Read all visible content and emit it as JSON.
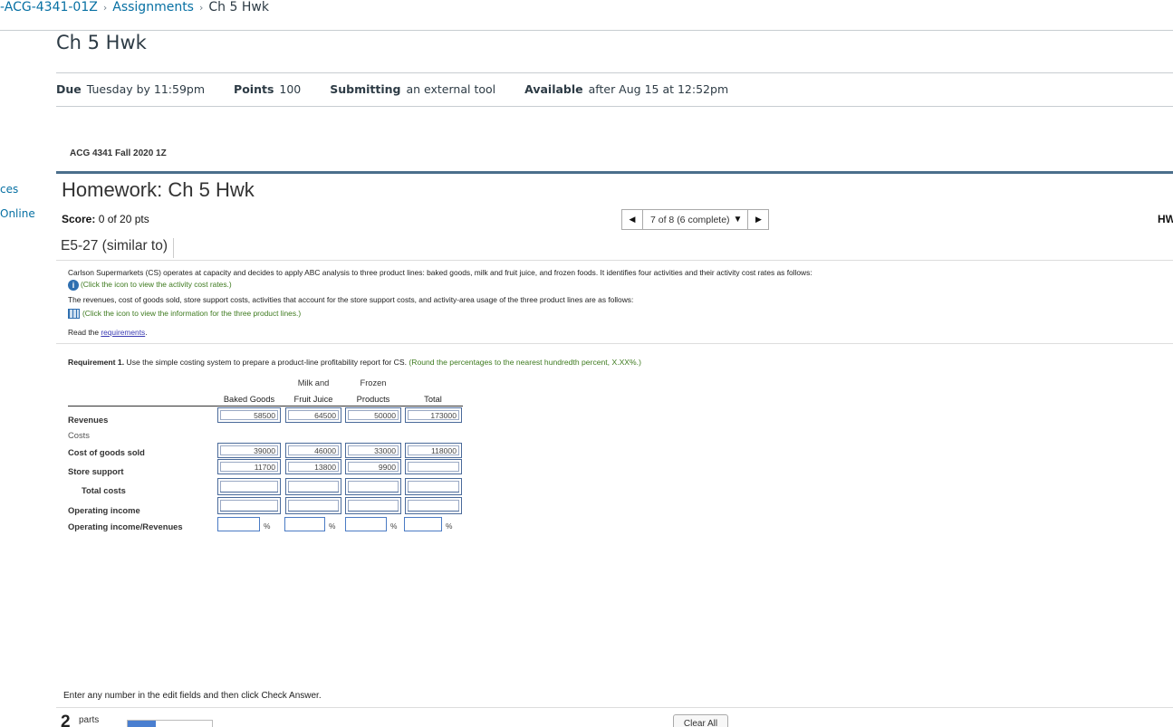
{
  "breadcrumb": {
    "course": "-ACG-4341-01Z",
    "assignments": "Assignments",
    "current": "Ch 5 Hwk"
  },
  "page_title": "Ch 5 Hwk",
  "details": {
    "due_label": "Due",
    "due_value": "Tuesday by 11:59pm",
    "points_label": "Points",
    "points_value": "100",
    "submitting_label": "Submitting",
    "submitting_value": "an external tool",
    "available_label": "Available",
    "available_value": "after Aug 15 at 12:52pm"
  },
  "left_nav": {
    "item1": "ces",
    "item2": "Online"
  },
  "course_name": "ACG 4341 Fall 2020 1Z",
  "homework": {
    "title": "Homework: Ch 5 Hwk",
    "score_label": "Score:",
    "score_value": "0 of 20 pts",
    "nav_position": "7 of 8 (6 complete)",
    "hw_cut": "HW"
  },
  "question": {
    "id": "E5-27 (similar to)",
    "line1": "Carlson Supermarkets (CS) operates at capacity and decides to apply ABC analysis to three product lines: baked goods, milk and fruit juice, and frozen foods. It identifies four activities and their activity cost rates as follows:",
    "link1": "(Click the icon to view the activity cost rates.)",
    "line2": "The revenues, cost of goods sold, store support costs, activities that account for the store support costs, and activity-area usage of the three product lines are as follows:",
    "link2": "(Click the icon to view the information for the three product lines.)",
    "read_prefix": "Read the ",
    "read_link": "requirements",
    "read_suffix": "."
  },
  "requirement": {
    "label": "Requirement 1.",
    "text": " Use the simple costing system to prepare a product-line profitability report for CS. ",
    "hint": "(Round the percentages to the nearest hundredth percent, X.XX%.)"
  },
  "table": {
    "col_baked": "Baked Goods",
    "col_milk_top": "Milk and",
    "col_milk": "Fruit Juice",
    "col_frozen_top": "Frozen",
    "col_frozen": "Products",
    "col_total": "Total",
    "rows": {
      "revenues": "Revenues",
      "costs": "Costs",
      "cogs": "Cost of goods sold",
      "store_support": "Store support",
      "total_costs": "Total costs",
      "operating_income": "Operating income",
      "oi_revenues": "Operating income/Revenues"
    },
    "revenues": [
      "58500",
      "64500",
      "50000",
      "173000"
    ],
    "cogs": [
      "39000",
      "46000",
      "33000",
      "118000"
    ],
    "store_support": [
      "11700",
      "13800",
      "9900",
      ""
    ],
    "total_costs": [
      "",
      "",
      "",
      ""
    ],
    "operating_income": [
      "",
      "",
      "",
      ""
    ],
    "pct_sign": "%"
  },
  "footer": {
    "note": "Enter any number in the edit fields and then click Check Answer.",
    "parts_num": "2",
    "parts_label": "parts",
    "clear_all": "Clear All",
    "progress_fraction": 0.33
  }
}
